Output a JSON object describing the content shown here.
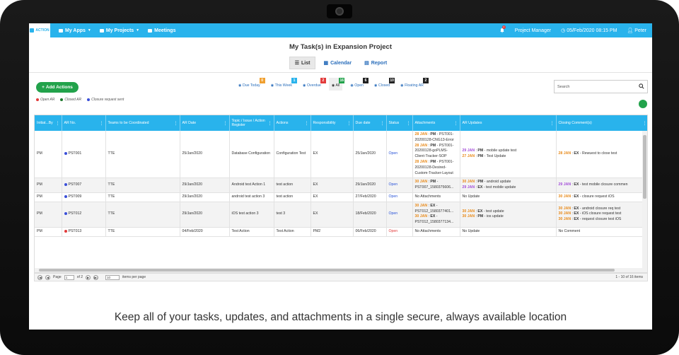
{
  "topbar": {
    "nav": [
      {
        "label": "My Apps"
      },
      {
        "label": "My Projects"
      },
      {
        "label": "Meetings"
      }
    ],
    "role": "Project Manager",
    "datetime": "05/Feb/2020 08:15 PM",
    "user": "Peter",
    "notification_count": "4"
  },
  "page_title": "My Task(s) in Expansion Project",
  "views": [
    {
      "label": "List"
    },
    {
      "label": "Calendar"
    },
    {
      "label": "Report"
    }
  ],
  "add_button": "Add Actions",
  "legend": [
    {
      "label": "Open AR",
      "color": "#e23b3b"
    },
    {
      "label": "Closed AR",
      "color": "#1e7a2d"
    },
    {
      "label": "Closure request sent",
      "color": "#3a4fd8"
    }
  ],
  "filters": [
    {
      "label": "Due Today",
      "count": "0",
      "color": "#f0a030"
    },
    {
      "label": "This Week",
      "count": "1",
      "color": "#29b3ec"
    },
    {
      "label": "Overdue",
      "count": "2",
      "color": "#e23b3b"
    },
    {
      "label": "All",
      "count": "16",
      "color": "#22a24b"
    },
    {
      "label": "Open",
      "count": "6",
      "color": "#222222"
    },
    {
      "label": "Closed",
      "count": "10",
      "color": "#222222"
    },
    {
      "label": "Floating AR",
      "count": "2",
      "color": "#222222"
    }
  ],
  "search": {
    "placeholder": "Search"
  },
  "columns": [
    "Initiat...By",
    "AR No.",
    "Teams to be Coordinated",
    "AR Date",
    "Topic / Issue / Action Register",
    "Actions",
    "Responsibility",
    "Due date",
    "Status",
    "Attachments",
    "AR Updates",
    "Closing Comment(s)"
  ],
  "rows": [
    {
      "by": "PM",
      "ar_no": "PST001",
      "dot": "#3a4fd8",
      "teams": "TTE",
      "ar_date": "25/Jan/2020",
      "topic": "Database Configuration",
      "actions": "Configuration Test",
      "resp": "EX",
      "due": "25/Jan/2020",
      "status": "Open",
      "attachments": [
        {
          "date": "28 JAN",
          "by": "PM",
          "text": "PST001-20200128-CNG13-Error"
        },
        {
          "date": "28 JAN",
          "by": "PM",
          "text": "PST001-20200128-goPLMS-Client-Tracker-SOP"
        },
        {
          "date": "28 JAN",
          "by": "PM",
          "text": "PST001-20200128-Desired-Custom-Tracker-Layout"
        }
      ],
      "updates": [
        {
          "date": "29 JAN",
          "by": "PM",
          "text": "mobile update test",
          "c": "p"
        },
        {
          "date": "27 JAN",
          "by": "PM",
          "text": "Test Update",
          "c": "o"
        }
      ],
      "closing": [
        {
          "date": "28 JAN",
          "by": "EX",
          "text": "Rewuest to close test",
          "c": "o"
        }
      ]
    },
    {
      "by": "PM",
      "ar_no": "PST007",
      "dot": "#3a4fd8",
      "teams": "TTE",
      "ar_date": "29/Jan/2020",
      "topic": "Android test Action 1",
      "actions": "test action",
      "resp": "EX",
      "due": "29/Jan/2020",
      "status": "Open",
      "attachments": [
        {
          "date": "30 JAN",
          "by": "PM",
          "text": "PST007_1580375606..."
        }
      ],
      "updates": [
        {
          "date": "30 JAN",
          "by": "PM",
          "text": "android update",
          "c": "o"
        },
        {
          "date": "29 JAN",
          "by": "EX",
          "text": "test mobile update",
          "c": "p"
        }
      ],
      "closing": [
        {
          "date": "29 JAN",
          "by": "EX",
          "text": "test mobile closure commen",
          "c": "p"
        }
      ]
    },
    {
      "by": "PM",
      "ar_no": "PST009",
      "dot": "#3a4fd8",
      "teams": "TTE",
      "ar_date": "29/Jan/2020",
      "topic": "android test action 3",
      "actions": "test action",
      "resp": "EX",
      "due": "27/Feb/2020",
      "status": "Open",
      "attachments": [
        {
          "plain": "No Attachments"
        }
      ],
      "updates": [
        {
          "plain": "No Update"
        }
      ],
      "closing": [
        {
          "date": "30 JAN",
          "by": "EX",
          "text": "closure request iOS",
          "c": "o"
        }
      ]
    },
    {
      "by": "PM",
      "ar_no": "PST012",
      "dot": "#3a4fd8",
      "teams": "TTE",
      "ar_date": "29/Jan/2020",
      "topic": "iOS test action 3",
      "actions": "test 3",
      "resp": "EX",
      "due": "18/Feb/2020",
      "status": "Open",
      "attachments": [
        {
          "date": "30 JAN",
          "by": "EX",
          "text": "PST012_1580377401..."
        },
        {
          "date": "30 JAN",
          "by": "EX",
          "text": "PST012_1580377134..."
        }
      ],
      "updates": [
        {
          "date": "30 JAN",
          "by": "EX",
          "text": "test update",
          "c": "o"
        },
        {
          "date": "30 JAN",
          "by": "PM",
          "text": "ios update",
          "c": "o"
        }
      ],
      "closing": [
        {
          "date": "30 JAN",
          "by": "EX",
          "text": "android closure req test",
          "c": "o"
        },
        {
          "date": "30 JAN",
          "by": "EX",
          "text": "iOS closure request test",
          "c": "o"
        },
        {
          "date": "30 JAN",
          "by": "EX",
          "text": "request closure test iOS",
          "c": "o"
        }
      ]
    },
    {
      "by": "PM",
      "ar_no": "PST013",
      "dot": "#e23b3b",
      "teams": "TTE",
      "ar_date": "04/Feb/2020",
      "topic": "Test Action",
      "actions": "Test Action",
      "resp": "PM2",
      "due": "06/Feb/2020",
      "status": "Open",
      "status_red": true,
      "attachments": [
        {
          "plain": "No Attachments"
        }
      ],
      "updates": [
        {
          "plain": "No Update"
        }
      ],
      "closing": [
        {
          "plain": "No Comment"
        }
      ]
    }
  ],
  "pager": {
    "page_label": "Page",
    "page": "1",
    "of_label": "of 2",
    "per_page": "10",
    "per_page_label": "items per page",
    "summary": "1 - 10 of 16 items"
  },
  "caption": "Keep all of your tasks, updates, and attachments in a single secure, always available location"
}
